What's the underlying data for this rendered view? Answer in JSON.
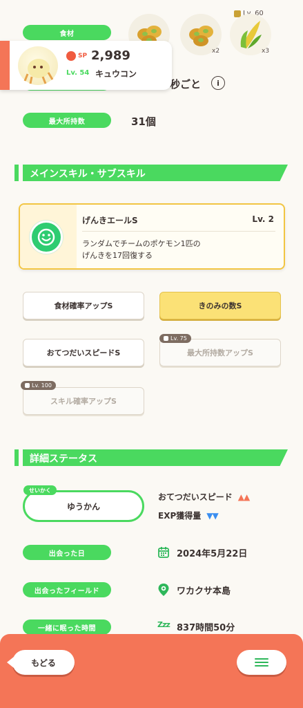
{
  "ingredients": {
    "label": "食材",
    "items": [
      {
        "name": "soybeans-icon",
        "count": ""
      },
      {
        "name": "soybeans-icon",
        "count": "x2"
      },
      {
        "name": "corn-icon",
        "count": "x3",
        "unlock_level": "Lv. 60"
      }
    ]
  },
  "pokemon": {
    "sp_label": "SP",
    "sp_value": "2,989",
    "level": "Lv. 54",
    "name": "キュウコン"
  },
  "help_interval": {
    "suffix": "秒ごと"
  },
  "max_carry": {
    "label": "最大所持数",
    "value": "31個"
  },
  "skills_section": {
    "title": "メインスキル・サブスキル"
  },
  "main_skill": {
    "name": "げんきエールS",
    "level": "Lv. 2",
    "desc_line1": "ランダムでチームのポケモン1匹の",
    "desc_line2": "げんきを17回復する"
  },
  "sub_skills": [
    {
      "label": "食材確率アップS",
      "style": "normal",
      "unlock": ""
    },
    {
      "label": "きのみの数S",
      "style": "gold",
      "unlock": ""
    },
    {
      "label": "おてつだいスピードS",
      "style": "normal",
      "unlock": ""
    },
    {
      "label": "最大所持数アップS",
      "style": "locked",
      "unlock": "Lv. 75"
    },
    {
      "label": "スキル確率アップS",
      "style": "locked",
      "unlock": "Lv. 100"
    }
  ],
  "details_section": {
    "title": "詳細ステータス"
  },
  "nature": {
    "tag": "せいかく",
    "value": "ゆうかん",
    "up_stat": "おてつだいスピード",
    "up_arrows": "▲▲",
    "down_stat": "EXP獲得量",
    "down_arrows": "▼▼"
  },
  "met_date": {
    "label": "出会った日",
    "value": "2024年5月22日"
  },
  "met_field": {
    "label": "出会ったフィールド",
    "value": "ワカクサ本島"
  },
  "sleep_time": {
    "label": "一緒に眠った時間",
    "value": "837時間50分",
    "icon_text": "Zzz"
  },
  "nav": {
    "back_label": "もどる"
  },
  "colors": {
    "accent_green": "#4ad95f",
    "accent_orange": "#f47557",
    "gold": "#fbe176"
  }
}
